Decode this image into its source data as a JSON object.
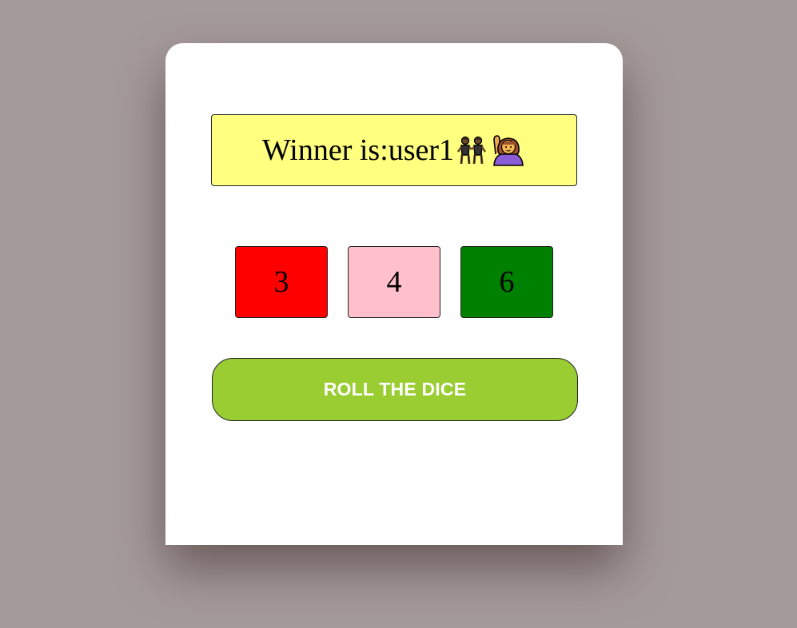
{
  "winner": {
    "prefix": "Winner is: ",
    "name": "user1",
    "icons": [
      "women-dancing-icon",
      "woman-raising-hand-icon"
    ],
    "background": "#ffff80"
  },
  "dice": [
    {
      "value": "3",
      "color": "#ff0000"
    },
    {
      "value": "4",
      "color": "#ffc0cb"
    },
    {
      "value": "6",
      "color": "#008000"
    }
  ],
  "roll_button": {
    "label": "ROLL THE DICE",
    "color": "#9acd32"
  }
}
